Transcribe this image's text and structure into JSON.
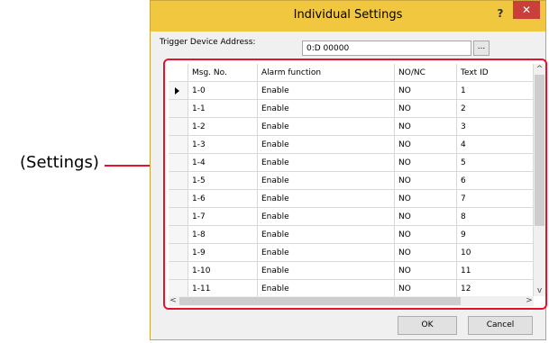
{
  "callout": {
    "label": "(Settings)",
    "color": "#e8112d"
  },
  "dialog": {
    "title": "Individual Settings",
    "help_label": "?",
    "close_label": "✕",
    "title_bar_color": "#f0c73f",
    "close_color": "#c9403a",
    "trigger": {
      "label": "Trigger Device Address:",
      "value": "0:D 00000",
      "browse_label": "..."
    },
    "table": {
      "columns": [
        "",
        "Msg. No.",
        "Alarm function",
        "NO/NC",
        "Text ID"
      ],
      "rows": [
        [
          "1-0",
          "Enable",
          "NO",
          "1"
        ],
        [
          "1-1",
          "Enable",
          "NO",
          "2"
        ],
        [
          "1-2",
          "Enable",
          "NO",
          "3"
        ],
        [
          "1-3",
          "Enable",
          "NO",
          "4"
        ],
        [
          "1-4",
          "Enable",
          "NO",
          "5"
        ],
        [
          "1-5",
          "Enable",
          "NO",
          "6"
        ],
        [
          "1-6",
          "Enable",
          "NO",
          "7"
        ],
        [
          "1-7",
          "Enable",
          "NO",
          "8"
        ],
        [
          "1-8",
          "Enable",
          "NO",
          "9"
        ],
        [
          "1-9",
          "Enable",
          "NO",
          "10"
        ],
        [
          "1-10",
          "Enable",
          "NO",
          "11"
        ],
        [
          "1-11",
          "Enable",
          "NO",
          "12"
        ]
      ],
      "selected_row": 0
    },
    "scroll": {
      "up": "^",
      "down": "v",
      "left": "<",
      "right": ">"
    },
    "buttons": {
      "ok": "OK",
      "cancel": "Cancel"
    }
  }
}
